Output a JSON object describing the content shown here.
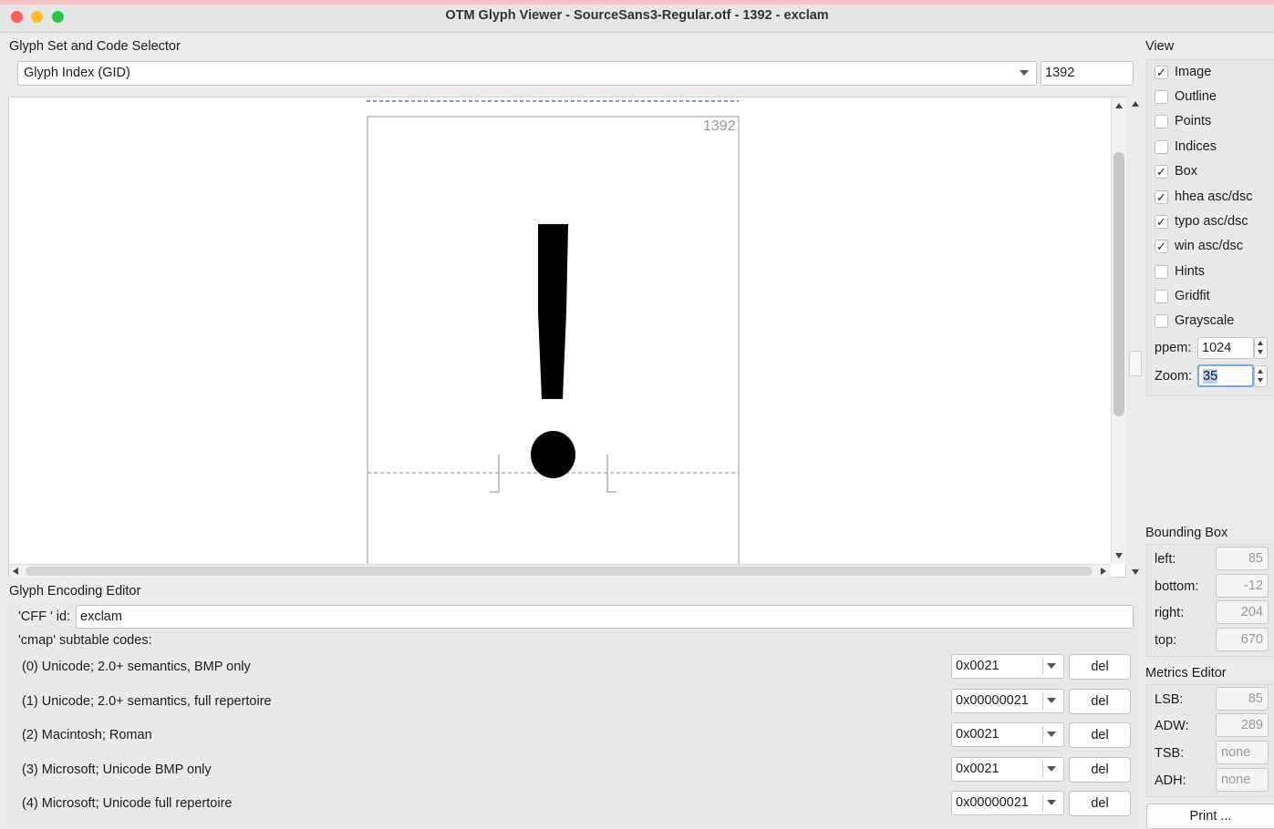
{
  "window": {
    "title": "OTM Glyph Viewer - SourceSans3-Regular.otf - 1392 - exclam",
    "traffic_colors": [
      "#fe5f57",
      "#febc2e",
      "#28c840"
    ]
  },
  "selector": {
    "heading": "Glyph Set and Code Selector",
    "mode_value": "Glyph Index (GID)",
    "gid_value": "1392"
  },
  "canvas": {
    "glyph_id_label": "1392",
    "glyph_char": "!"
  },
  "view": {
    "heading": "View",
    "options": [
      {
        "label": "Image",
        "checked": true
      },
      {
        "label": "Outline",
        "checked": false
      },
      {
        "label": "Points",
        "checked": false
      },
      {
        "label": "Indices",
        "checked": false
      },
      {
        "label": "Box",
        "checked": true
      },
      {
        "label": "hhea asc/dsc",
        "checked": true
      },
      {
        "label": "typo asc/dsc",
        "checked": true
      },
      {
        "label": "win asc/dsc",
        "checked": true
      },
      {
        "label": "Hints",
        "checked": false
      },
      {
        "label": "Gridfit",
        "checked": false
      },
      {
        "label": "Grayscale",
        "checked": false
      }
    ],
    "ppem_label": "ppem:",
    "ppem_value": "1024",
    "zoom_label": "Zoom:",
    "zoom_value": "35",
    "check_mark": "✓"
  },
  "bounding_box": {
    "heading": "Bounding Box",
    "left_label": "left:",
    "left_value": "85",
    "bottom_label": "bottom:",
    "bottom_value": "-12",
    "right_label": "right:",
    "right_value": "204",
    "top_label": "top:",
    "top_value": "670"
  },
  "metrics": {
    "heading": "Metrics Editor",
    "lsb_label": "LSB:",
    "lsb_value": "85",
    "adw_label": "ADW:",
    "adw_value": "289",
    "tsb_label": "TSB:",
    "tsb_value": "none",
    "adh_label": "ADH:",
    "adh_value": "none",
    "print_label": "Print ..."
  },
  "encoding": {
    "heading": "Glyph Encoding Editor",
    "cff_label": "'CFF ' id:",
    "cff_value": "exclam",
    "cmap_label": "'cmap' subtable codes:",
    "del_label": "del",
    "rows": [
      {
        "label": "(0) Unicode; 2.0+ semantics, BMP only",
        "code": "0x0021"
      },
      {
        "label": "(1) Unicode; 2.0+ semantics, full repertoire",
        "code": "0x00000021"
      },
      {
        "label": "(2) Macintosh; Roman",
        "code": "0x0021"
      },
      {
        "label": "(3) Microsoft; Unicode BMP only",
        "code": "0x0021"
      },
      {
        "label": "(4) Microsoft; Unicode full repertoire",
        "code": "0x00000021"
      }
    ]
  }
}
